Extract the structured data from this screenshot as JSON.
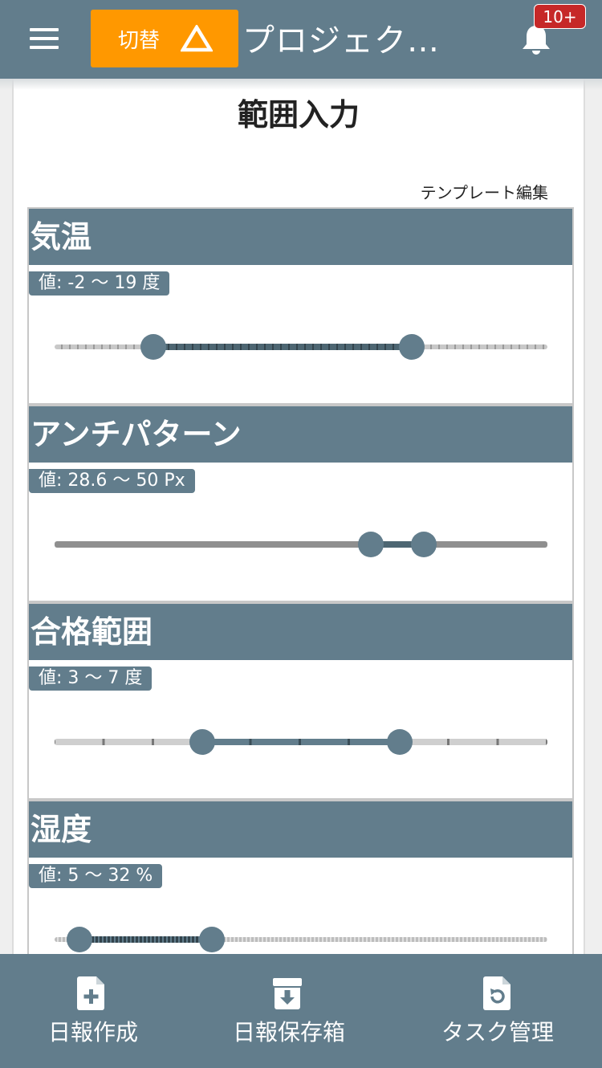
{
  "header": {
    "switch_label": "切替",
    "title": "プロジェク…",
    "badge": "10+"
  },
  "page": {
    "title": "範囲入力",
    "template_edit": "テンプレート編集"
  },
  "sliders": [
    {
      "title": "気温",
      "value_prefix": "値: ",
      "low_text": "-2",
      "sep": " 〜 ",
      "high_text": "19",
      "unit": " 度",
      "min": -10,
      "max": 30,
      "low": -2,
      "high": 19,
      "track_style": "dashed"
    },
    {
      "title": "アンチパターン",
      "value_prefix": "値: ",
      "low_text": "28.6",
      "sep": " 〜 ",
      "high_text": "50",
      "unit": " Px",
      "min": 0,
      "max": 80,
      "low": 51.4,
      "high": 59.9,
      "track_style": "solid"
    },
    {
      "title": "合格範囲",
      "value_prefix": "値: ",
      "low_text": "3",
      "sep": " 〜 ",
      "high_text": "7",
      "unit": " 度",
      "min": 0,
      "max": 10,
      "low": 3,
      "high": 7,
      "track_style": "ticks"
    },
    {
      "title": "湿度",
      "value_prefix": "値: ",
      "low_text": "5",
      "sep": " 〜 ",
      "high_text": "32",
      "unit": " %",
      "min": 0,
      "max": 100,
      "low": 5,
      "high": 32,
      "track_style": "fine"
    }
  ],
  "bottom_nav": [
    {
      "label": "日報作成",
      "icon": "file-plus-icon"
    },
    {
      "label": "日報保存箱",
      "icon": "archive-download-icon"
    },
    {
      "label": "タスク管理",
      "icon": "file-refresh-icon"
    }
  ],
  "colors": {
    "primary": "#627d8c",
    "accent": "#ff9800",
    "badge": "#c62828"
  }
}
